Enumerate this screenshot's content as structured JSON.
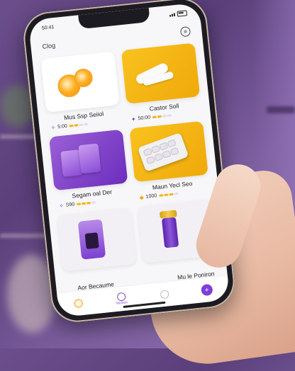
{
  "status": {
    "time": "50:41"
  },
  "header": {
    "title": "Clog",
    "settings_icon": "settings-icon"
  },
  "products": [
    {
      "name": "Mus Ssp Seiiol",
      "price": "5:00",
      "price_icon": "star-icon",
      "rating": 2,
      "art": "orange-slices"
    },
    {
      "name": "Castor Soll",
      "price": "50:00",
      "price_icon": "tag-icon",
      "rating": 2,
      "art": "spoons"
    },
    {
      "name": "Segam oal Der",
      "price": "S90",
      "price_icon": "bag-icon",
      "rating": 3,
      "art": "purple-packs"
    },
    {
      "name": "Maun Yecl Seo",
      "price": "1000",
      "price_icon": "tag-icon",
      "rating": 3,
      "art": "cookie-tray"
    },
    {
      "name": "Aor Becaume",
      "art": "purple-device"
    },
    {
      "name": "Mu le Poniron",
      "art": "purple-jar"
    }
  ],
  "tabbar": [
    {
      "label": "",
      "icon": "home-icon"
    },
    {
      "label": "Mtdoon",
      "icon": "heart-icon"
    },
    {
      "label": "",
      "icon": "bag-icon"
    },
    {
      "label": "",
      "icon": "plus-icon"
    }
  ],
  "colors": {
    "accent": "#7c3fd8",
    "yellow": "#f8c21f"
  }
}
